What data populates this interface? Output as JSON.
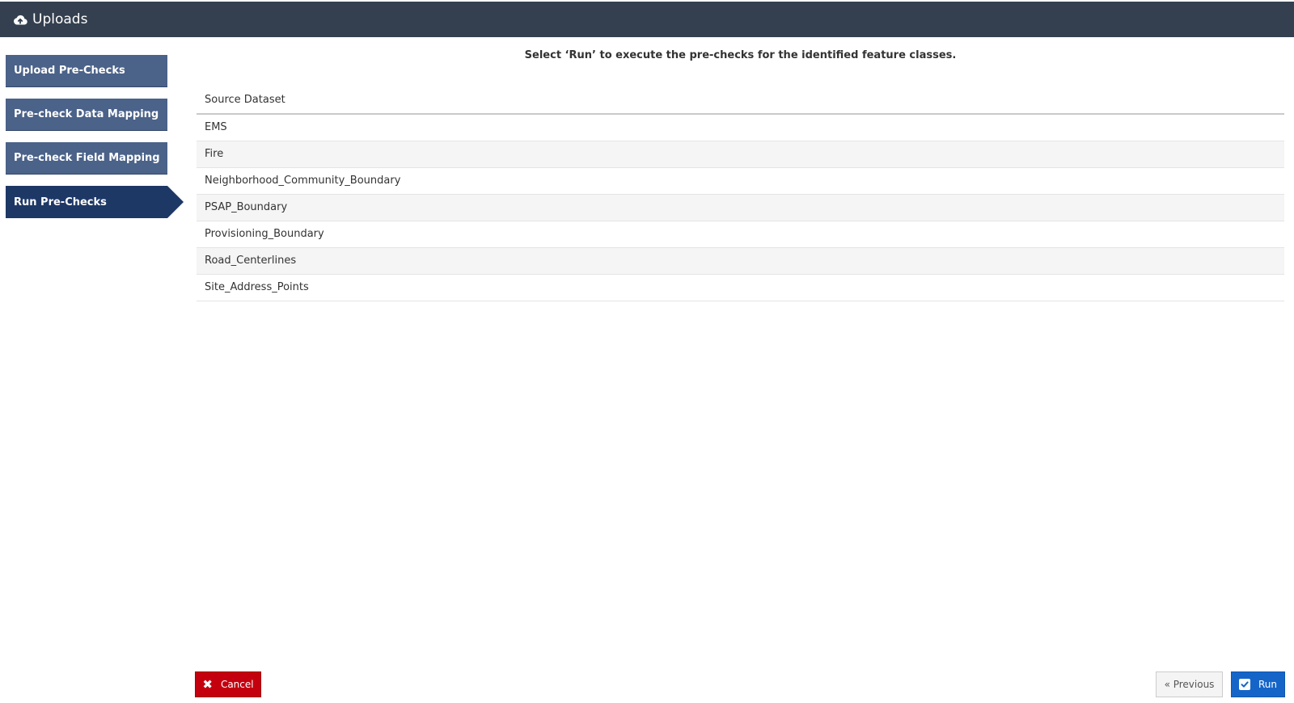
{
  "header": {
    "title": "Uploads",
    "icon": "cloud-upload-icon"
  },
  "steps": [
    {
      "label": "Upload Pre-Checks"
    },
    {
      "label": "Pre-check Data Mapping"
    },
    {
      "label": "Pre-check Field Mapping"
    },
    {
      "label": "Run Pre-Checks",
      "active": true
    }
  ],
  "main": {
    "instruction": "Select ‘Run’ to execute the pre-checks for the identified feature classes.",
    "table": {
      "header": "Source Dataset",
      "rows": [
        "EMS",
        "Fire",
        "Neighborhood_Community_Boundary",
        "PSAP_Boundary",
        "Provisioning_Boundary",
        "Road_Centerlines",
        "Site_Address_Points"
      ]
    }
  },
  "footer": {
    "cancel_label": "Cancel",
    "previous_label": "« Previous",
    "run_label": "Run"
  },
  "colors": {
    "header_bg": "#34404f",
    "step_bg": "#4b6289",
    "step_active_bg": "#1e3866",
    "cancel_bg": "#c4000f",
    "run_bg": "#1565c9"
  }
}
